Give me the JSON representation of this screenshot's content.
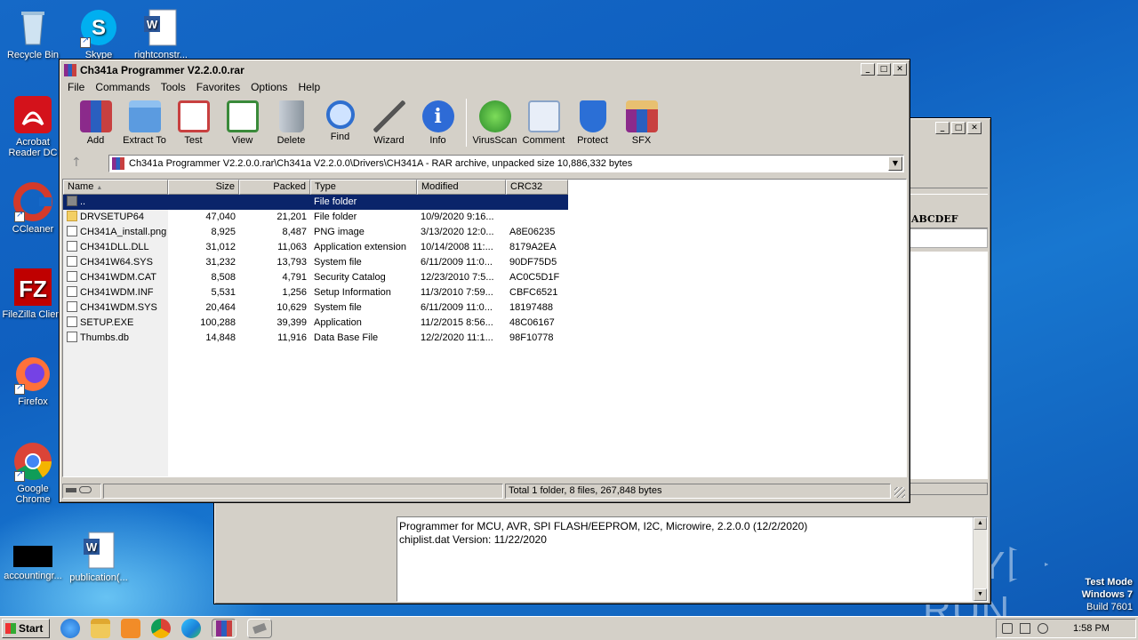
{
  "desktop": {
    "icons": [
      {
        "label": "Recycle Bin"
      },
      {
        "label": "Skype"
      },
      {
        "label": "rightconstr..."
      },
      {
        "label": "Acrobat Reader DC"
      },
      {
        "label": "CCleaner"
      },
      {
        "label": "FileZilla Client"
      },
      {
        "label": "Firefox"
      },
      {
        "label": "Google Chrome"
      },
      {
        "label": "accountingr..."
      },
      {
        "label": "publication(..."
      }
    ],
    "watermark": {
      "left": "ANY",
      "right": "RUN"
    },
    "os_info": {
      "line1": "Test Mode",
      "line2": "Windows 7",
      "line3": "Build 7601"
    }
  },
  "back_window": {
    "header_text": "ABCDEF",
    "log_lines": [
      "Programmer for MCU, AVR, SPI FLASH/EEPROM, I2C, Microwire, 2.2.0.0 (12/2/2020)",
      "chiplist.dat Version: 11/22/2020"
    ]
  },
  "winrar": {
    "title": "Ch341a Programmer V2.2.0.0.rar",
    "menu": [
      "File",
      "Commands",
      "Tools",
      "Favorites",
      "Options",
      "Help"
    ],
    "toolbar": [
      {
        "label": "Add",
        "icon": "add-archive-icon",
        "color": "#c0392b"
      },
      {
        "label": "Extract To",
        "icon": "extract-folder-icon",
        "color": "#3b7dd8"
      },
      {
        "label": "Test",
        "icon": "test-clipboard-icon",
        "color": "#d04040"
      },
      {
        "label": "View",
        "icon": "view-book-icon",
        "color": "#3a8a3a"
      },
      {
        "label": "Delete",
        "icon": "delete-trash-icon",
        "color": "#9aa4ae"
      },
      {
        "label": "Find",
        "icon": "find-magnifier-icon",
        "color": "#2f6fcf"
      },
      {
        "label": "Wizard",
        "icon": "wizard-wand-icon",
        "color": "#8fbf40"
      },
      {
        "label": "Info",
        "icon": "info-icon",
        "color": "#2e6bd6"
      },
      {
        "label": "VirusScan",
        "icon": "virus-scan-icon",
        "color": "#3fae3f"
      },
      {
        "label": "Comment",
        "icon": "comment-icon",
        "color": "#8aa4c8"
      },
      {
        "label": "Protect",
        "icon": "protect-shield-icon",
        "color": "#2b6fd6"
      },
      {
        "label": "SFX",
        "icon": "sfx-box-icon",
        "color": "#d5a23a"
      }
    ],
    "address": "Ch341a Programmer V2.2.0.0.rar\\Ch341a V2.2.0.0\\Drivers\\CH341A - RAR archive, unpacked size 10,886,332 bytes",
    "columns": [
      "Name",
      "Size",
      "Packed",
      "Type",
      "Modified",
      "CRC32"
    ],
    "files": [
      {
        "name": "..",
        "size": "",
        "packed": "",
        "type": "File folder",
        "modified": "",
        "crc": "",
        "kind": "up"
      },
      {
        "name": "DRVSETUP64",
        "size": "47,040",
        "packed": "21,201",
        "type": "File folder",
        "modified": "10/9/2020 9:16...",
        "crc": "",
        "kind": "folder"
      },
      {
        "name": "CH341A_install.png",
        "size": "8,925",
        "packed": "8,487",
        "type": "PNG image",
        "modified": "3/13/2020 12:0...",
        "crc": "A8E06235",
        "kind": "file"
      },
      {
        "name": "CH341DLL.DLL",
        "size": "31,012",
        "packed": "11,063",
        "type": "Application extension",
        "modified": "10/14/2008 11:...",
        "crc": "8179A2EA",
        "kind": "file"
      },
      {
        "name": "CH341W64.SYS",
        "size": "31,232",
        "packed": "13,793",
        "type": "System file",
        "modified": "6/11/2009 11:0...",
        "crc": "90DF75D5",
        "kind": "file"
      },
      {
        "name": "CH341WDM.CAT",
        "size": "8,508",
        "packed": "4,791",
        "type": "Security Catalog",
        "modified": "12/23/2010 7:5...",
        "crc": "AC0C5D1F",
        "kind": "file"
      },
      {
        "name": "CH341WDM.INF",
        "size": "5,531",
        "packed": "1,256",
        "type": "Setup Information",
        "modified": "11/3/2010 7:59...",
        "crc": "CBFC6521",
        "kind": "file"
      },
      {
        "name": "CH341WDM.SYS",
        "size": "20,464",
        "packed": "10,629",
        "type": "System file",
        "modified": "6/11/2009 11:0...",
        "crc": "18197488",
        "kind": "file"
      },
      {
        "name": "SETUP.EXE",
        "size": "100,288",
        "packed": "39,399",
        "type": "Application",
        "modified": "11/2/2015 8:56...",
        "crc": "48C06167",
        "kind": "file"
      },
      {
        "name": "Thumbs.db",
        "size": "14,848",
        "packed": "11,916",
        "type": "Data Base File",
        "modified": "12/2/2020 11:1...",
        "crc": "98F10778",
        "kind": "file"
      }
    ],
    "status": "Total 1 folder, 8 files, 267,848 bytes"
  },
  "taskbar": {
    "start_label": "Start",
    "clock": "1:58 PM"
  }
}
